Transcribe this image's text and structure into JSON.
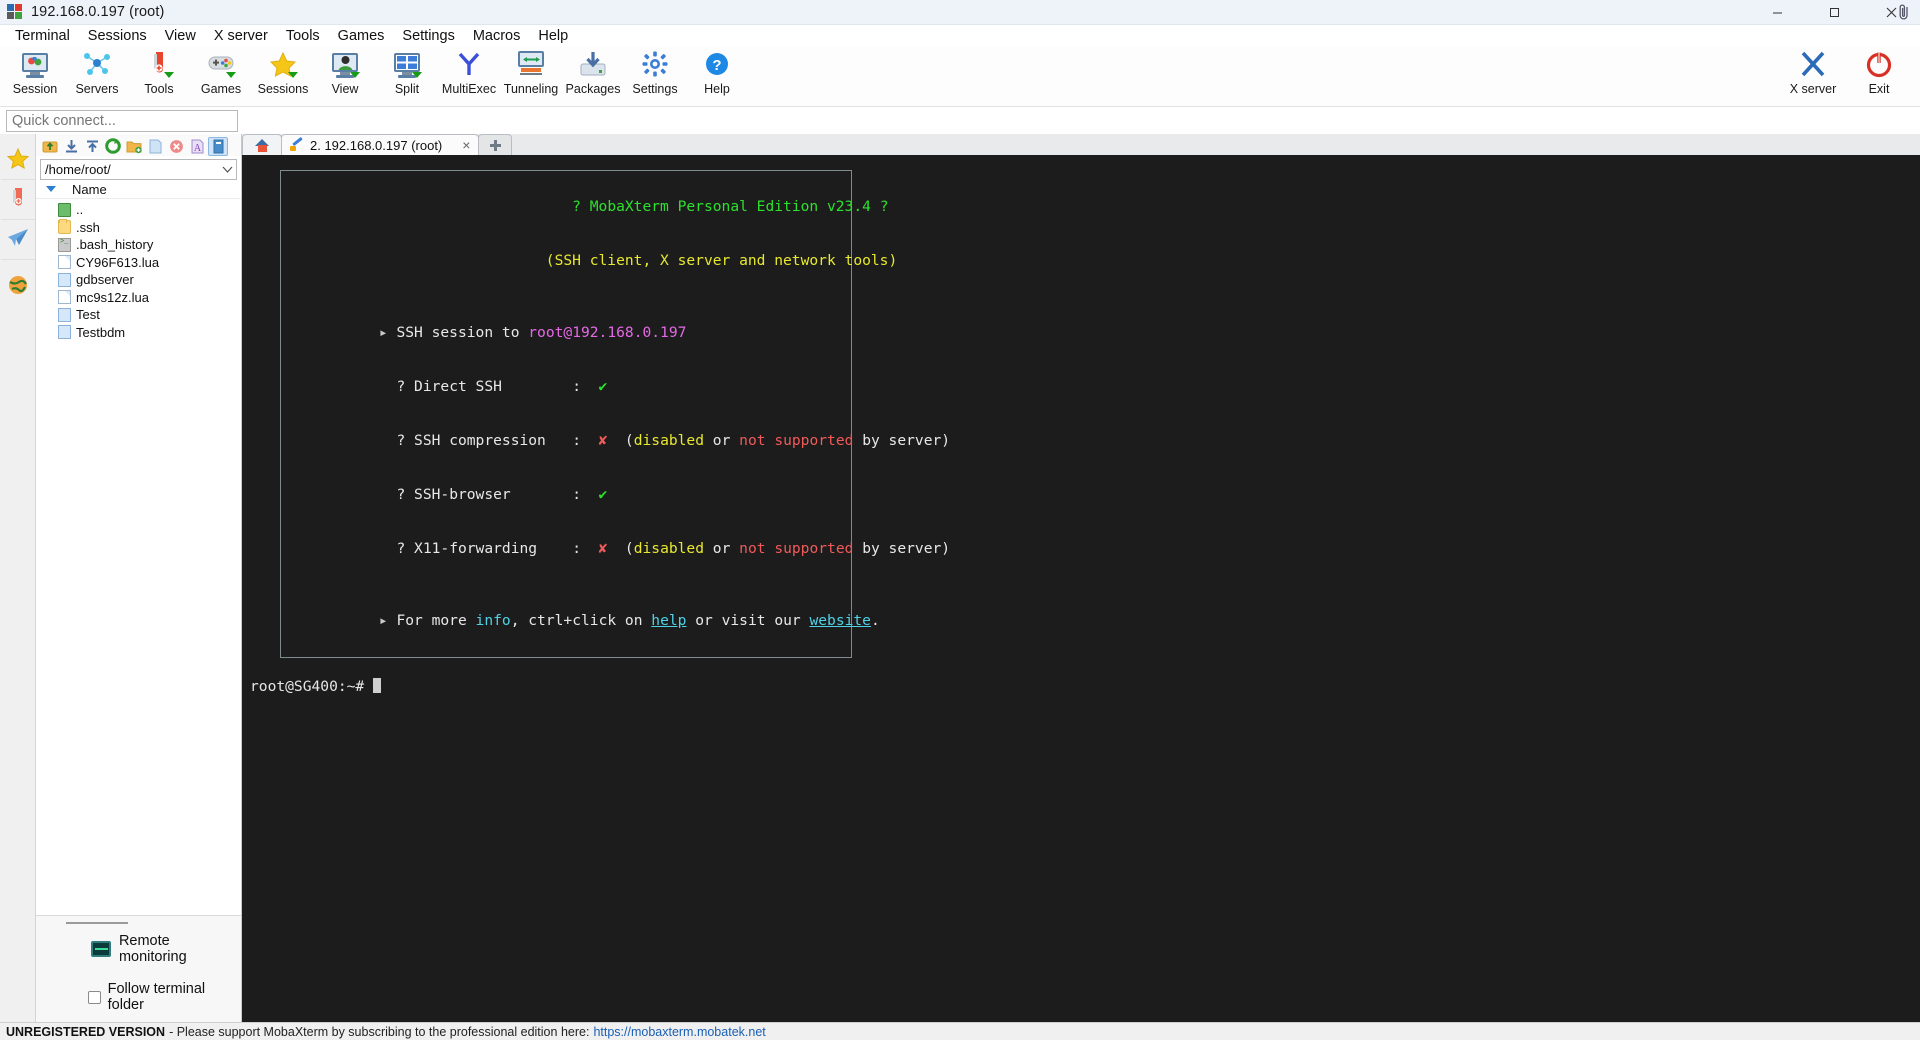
{
  "window": {
    "title": "192.168.0.197 (root)",
    "minimize": "minimize",
    "maximize": "maximize",
    "close": "close"
  },
  "menubar": {
    "items": [
      "Terminal",
      "Sessions",
      "View",
      "X server",
      "Tools",
      "Games",
      "Settings",
      "Macros",
      "Help"
    ]
  },
  "toolbar": {
    "buttons": [
      {
        "label": "Session",
        "icon": "session-monitor-icon"
      },
      {
        "label": "Servers",
        "icon": "servers-network-icon"
      },
      {
        "label": "Tools",
        "icon": "tools-knife-icon"
      },
      {
        "label": "Games",
        "icon": "games-gamepad-icon"
      },
      {
        "label": "Sessions",
        "icon": "sessions-star-icon"
      },
      {
        "label": "View",
        "icon": "view-monitor-icon"
      },
      {
        "label": "Split",
        "icon": "split-panes-icon"
      },
      {
        "label": "MultiExec",
        "icon": "multiexec-fork-icon"
      },
      {
        "label": "Tunneling",
        "icon": "tunneling-icon"
      },
      {
        "label": "Packages",
        "icon": "packages-download-icon"
      },
      {
        "label": "Settings",
        "icon": "settings-gear-icon"
      },
      {
        "label": "Help",
        "icon": "help-question-icon"
      }
    ],
    "right_buttons": [
      {
        "label": "X server",
        "icon": "xserver-x-icon"
      },
      {
        "label": "Exit",
        "icon": "exit-power-icon"
      }
    ]
  },
  "quick_connect": {
    "placeholder": "Quick connect...",
    "value": ""
  },
  "rail": {
    "items": [
      {
        "name": "favorites-star-icon"
      },
      {
        "name": "tools-knife-icon"
      },
      {
        "name": "send-paperplane-icon"
      },
      {
        "name": "globe-world-icon"
      }
    ]
  },
  "browser": {
    "toolbar_icons": [
      "parent-folder-icon",
      "download-icon",
      "upload-icon",
      "refresh-icon",
      "new-folder-icon",
      "new-file-icon",
      "delete-icon",
      "text-mode-icon",
      "binary-mode-icon"
    ],
    "path": "/home/root/",
    "path_caret": "⌄",
    "column_header": "Name",
    "files": [
      {
        "name": "..",
        "type": "up"
      },
      {
        "name": ".ssh",
        "type": "folder"
      },
      {
        "name": ".bash_history",
        "type": "term"
      },
      {
        "name": "CY96F613.lua",
        "type": "doc"
      },
      {
        "name": "gdbserver",
        "type": "doc2"
      },
      {
        "name": "mc9s12z.lua",
        "type": "doc"
      },
      {
        "name": "Test",
        "type": "doc2"
      },
      {
        "name": "Testbdm",
        "type": "doc2"
      }
    ],
    "remote_monitoring": "Remote monitoring",
    "follow_terminal_folder": "Follow terminal folder",
    "follow_checked": false
  },
  "tabs": {
    "home_tab": "home",
    "session_tab": "2. 192.168.0.197 (root)",
    "close_glyph": "×",
    "new_tab": "new-tab"
  },
  "terminal": {
    "banner": {
      "line1_marks": "?",
      "title": "MobaXterm Personal Edition v23.4",
      "subtitle": "(SSH client, X server and network tools)",
      "session_bullet": "▸",
      "session_label": "SSH session to ",
      "session_user": "root@192.168.0.197",
      "rows": [
        {
          "q": "?",
          "label": "Direct SSH",
          "status": "ok",
          "ok_glyph": "✔",
          "note": ""
        },
        {
          "q": "?",
          "label": "SSH compression",
          "status": "fail",
          "fail_glyph": "✘",
          "note_open": "(",
          "note_yellow": "disabled",
          "note_or": " or ",
          "note_red": "not supported",
          "note_tail": " by server)"
        },
        {
          "q": "?",
          "label": "SSH-browser",
          "status": "ok",
          "ok_glyph": "✔",
          "note": ""
        },
        {
          "q": "?",
          "label": "X11-forwarding",
          "status": "fail",
          "fail_glyph": "✘",
          "note_open": "(",
          "note_yellow": "disabled",
          "note_or": " or ",
          "note_red": "not supported",
          "note_tail": " by server)"
        }
      ],
      "footer_bullet": "▸",
      "footer_a": "For more ",
      "footer_info": "info",
      "footer_b": ", ctrl+click on ",
      "footer_help": "help",
      "footer_c": " or visit our ",
      "footer_website": "website",
      "footer_d": "."
    },
    "prompt": "root@SG400:~# "
  },
  "statusbar": {
    "unregistered": "UNREGISTERED VERSION",
    "message": "- Please support MobaXterm by subscribing to the professional edition here:",
    "link": "https://mobaxterm.mobatek.net"
  },
  "colors": {
    "accent": "#1a5fb4",
    "terminal_bg": "#1c1c1c",
    "green": "#2ee02e",
    "yellow": "#e8e82e",
    "red": "#f05a5a",
    "pink": "#e668e6",
    "cyan": "#4fd2e8"
  }
}
